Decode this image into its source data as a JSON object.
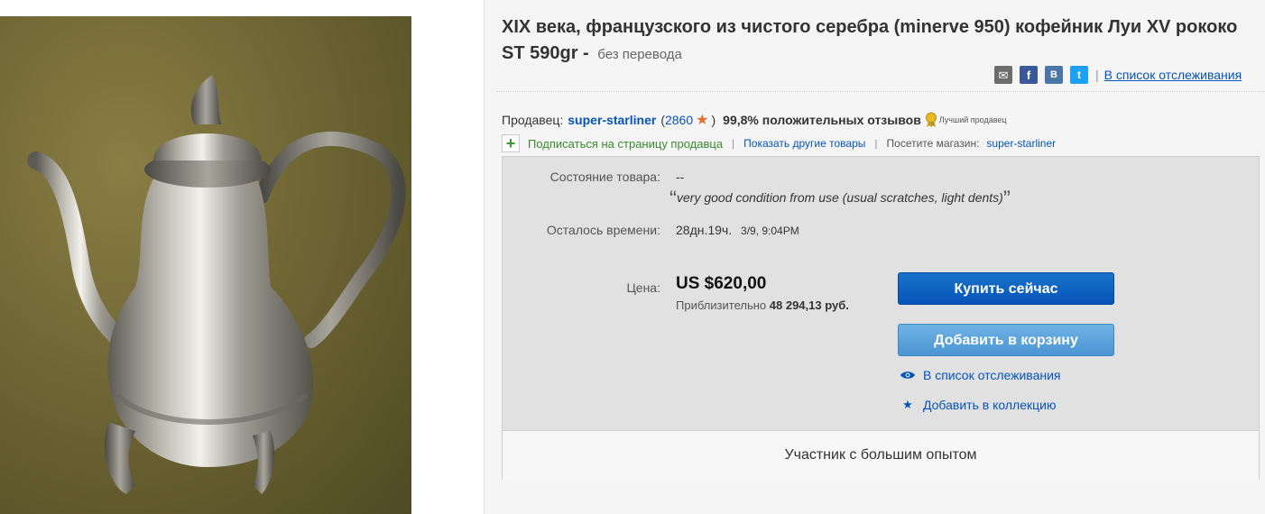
{
  "image": {
    "subject": "silver-coffee-pot-icon"
  },
  "title": {
    "main": "XIX века, французского из чистого серебра (minerve 950) кофейник Луи XV рококо ST 590gr -",
    "no_translate": "без перевода"
  },
  "share": {
    "icons": [
      "mail-icon",
      "facebook-icon",
      "vk-icon",
      "twitter-icon"
    ],
    "watch_link": "В список отслеживания"
  },
  "seller": {
    "label": "Продавец:",
    "name": "super-starliner",
    "feedback_open": "(",
    "feedback_count": "2860",
    "feedback_close": ")",
    "positive": "99,8% положительных отзывов",
    "top_seller": "Лучший продавец"
  },
  "links": {
    "follow": "Подписаться на страницу продавца",
    "other_items": "Показать другие товары",
    "visit_store_label": "Посетите магазин:",
    "store_name": "super-starliner"
  },
  "details": {
    "condition_label": "Состояние товара:",
    "condition_value": "--",
    "condition_quote": "very good condition from use (usual scratches, light dents)",
    "quote_open": "“",
    "quote_close": "”",
    "time_label": "Осталось времени:",
    "time_left": "28дн.19ч.",
    "time_end": "3/9, 9:04PM",
    "price_label": "Цена:",
    "price": "US $620,00",
    "approx_label": "Приблизительно",
    "approx_value": "48 294,13 руб.",
    "buy_button": "Купить сейчас",
    "cart_button": "Добавить в корзину",
    "watch_action": "В список отслеживания",
    "collection_action": "Добавить в коллекцию",
    "experienced": "Участник с большим опытом"
  },
  "colors": {
    "link_blue": "#0654ba",
    "buy_button": "#0654ba",
    "cart_button": "#4a95d3",
    "follow_green": "#3a8a2f",
    "star_orange": "#e0702a"
  }
}
